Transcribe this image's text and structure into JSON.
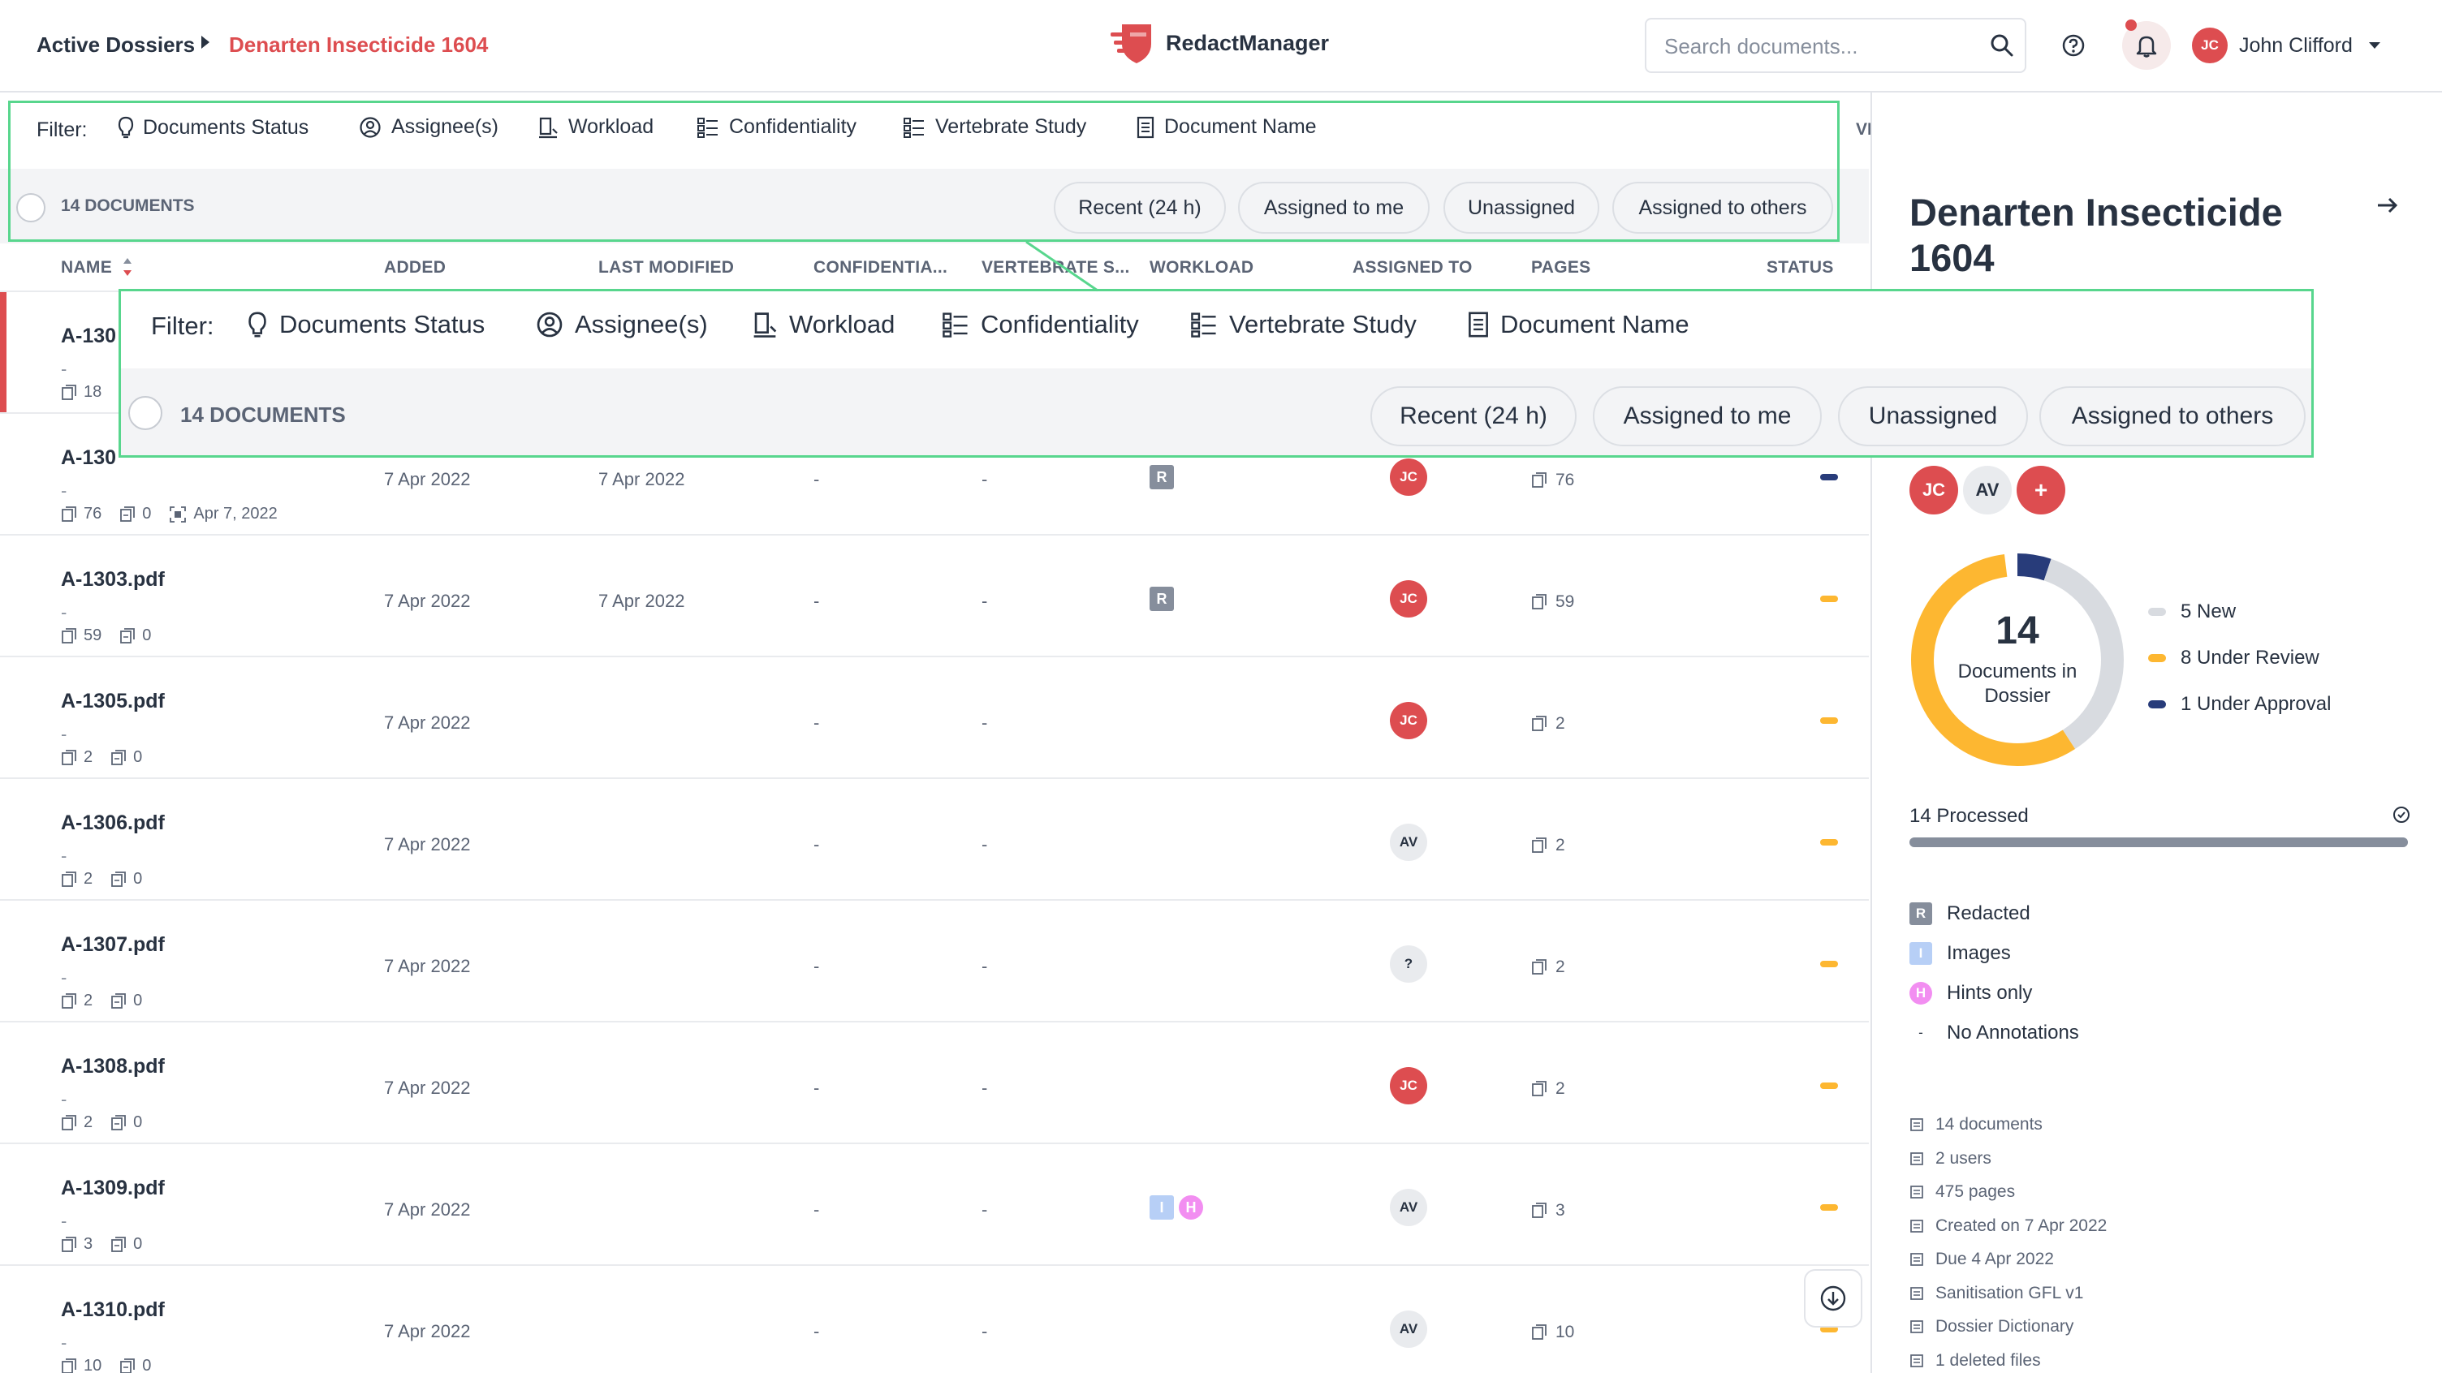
{
  "header": {
    "breadcrumb_root": "Active Dossiers",
    "breadcrumb_current": "Denarten Insecticide 1604",
    "app_name": "RedactManager",
    "search_placeholder": "Search documents...",
    "user_initials": "JC",
    "user_name": "John Clifford"
  },
  "filters": {
    "label": "Filter:",
    "items": [
      "Documents Status",
      "Assignee(s)",
      "Workload",
      "Confidentiality",
      "Vertebrate Study",
      "Document Name"
    ]
  },
  "doc_count": "14 DOCUMENTS",
  "quick_filters": [
    "Recent (24 h)",
    "Assigned to me",
    "Unassigned",
    "Assigned to others"
  ],
  "view_as_label": "VIEW AS:",
  "columns": [
    "NAME",
    "ADDED",
    "LAST MODIFIED",
    "CONFIDENTIA...",
    "VERTEBRATE S...",
    "WORKLOAD",
    "ASSIGNED TO",
    "PAGES",
    "STATUS"
  ],
  "rows": [
    {
      "name": "A-130",
      "dash": "-",
      "pages_meta": "18",
      "added": "",
      "modified": "",
      "conf": "",
      "vert": "",
      "workload": "",
      "assignee": "",
      "pages": "",
      "status_color": "",
      "red_marker": true
    },
    {
      "name": "A-130",
      "dash": "-",
      "pages_meta": "76",
      "annot_meta": "0",
      "date_meta": "Apr 7, 2022",
      "added": "7 Apr 2022",
      "modified": "7 Apr 2022",
      "conf": "-",
      "vert": "-",
      "workload": "R",
      "assignee": "JC",
      "pages": "76",
      "status_color": "#283c7a"
    },
    {
      "name": "A-1303.pdf",
      "dash": "-",
      "pages_meta": "59",
      "annot_meta": "0",
      "added": "7 Apr 2022",
      "modified": "7 Apr 2022",
      "conf": "-",
      "vert": "-",
      "workload": "R",
      "assignee": "JC",
      "pages": "59",
      "status_color": "#fdb731"
    },
    {
      "name": "A-1305.pdf",
      "dash": "-",
      "pages_meta": "2",
      "annot_meta": "0",
      "added": "7 Apr 2022",
      "modified": "",
      "conf": "-",
      "vert": "-",
      "workload": "",
      "assignee": "JC",
      "pages": "2",
      "status_color": "#fdb731"
    },
    {
      "name": "A-1306.pdf",
      "dash": "-",
      "pages_meta": "2",
      "annot_meta": "0",
      "added": "7 Apr 2022",
      "modified": "",
      "conf": "-",
      "vert": "-",
      "workload": "",
      "assignee": "AV",
      "pages": "2",
      "status_color": "#fdb731"
    },
    {
      "name": "A-1307.pdf",
      "dash": "-",
      "pages_meta": "2",
      "annot_meta": "0",
      "added": "7 Apr 2022",
      "modified": "",
      "conf": "-",
      "vert": "-",
      "workload": "",
      "assignee": "?",
      "pages": "2",
      "status_color": "#fdb731"
    },
    {
      "name": "A-1308.pdf",
      "dash": "-",
      "pages_meta": "2",
      "annot_meta": "0",
      "added": "7 Apr 2022",
      "modified": "",
      "conf": "-",
      "vert": "-",
      "workload": "",
      "assignee": "JC",
      "pages": "2",
      "status_color": "#fdb731"
    },
    {
      "name": "A-1309.pdf",
      "dash": "-",
      "pages_meta": "3",
      "annot_meta": "0",
      "added": "7 Apr 2022",
      "modified": "",
      "conf": "-",
      "vert": "-",
      "workload": "IH",
      "assignee": "AV",
      "pages": "3",
      "status_color": "#fdb731"
    },
    {
      "name": "A-1310.pdf",
      "dash": "-",
      "pages_meta": "10",
      "annot_meta": "0",
      "added": "7 Apr 2022",
      "modified": "",
      "conf": "-",
      "vert": "-",
      "workload": "",
      "assignee": "AV",
      "pages": "10",
      "status_color": "#fdb731"
    }
  ],
  "panel": {
    "title": "Denarten Insecticide 1604",
    "members": [
      "JC",
      "AV"
    ],
    "add_member": "+",
    "donut_total": "14",
    "donut_label": "Documents in Dossier",
    "donut_legend": [
      {
        "label": "5 New",
        "value": 5,
        "color": "#d8dbe0"
      },
      {
        "label": "8 Under Review",
        "value": 8,
        "color": "#fdb731"
      },
      {
        "label": "1 Under Approval",
        "value": 1,
        "color": "#283c7a"
      }
    ],
    "processed_label": "14 Processed",
    "processed_fraction": 1.0,
    "annotations": [
      {
        "letter": "R",
        "label": "Redacted",
        "color": "#868e9c"
      },
      {
        "letter": "I",
        "label": "Images",
        "color": "#b7cff6"
      },
      {
        "letter": "H",
        "label": "Hints only",
        "color": "#f28ef1"
      },
      {
        "letter": "-",
        "label": "No Annotations",
        "color": ""
      }
    ],
    "info": [
      "14 documents",
      "2 users",
      "475 pages",
      "Created on 7 Apr 2022",
      "Due 4 Apr 2022",
      "Sanitisation GFL v1",
      "Dossier Dictionary",
      "1 deleted files"
    ]
  },
  "colors": {
    "brand_red": "#dd4d50",
    "status_review": "#fdb731",
    "status_approval": "#283c7a",
    "highlight_green": "#58d68d"
  }
}
